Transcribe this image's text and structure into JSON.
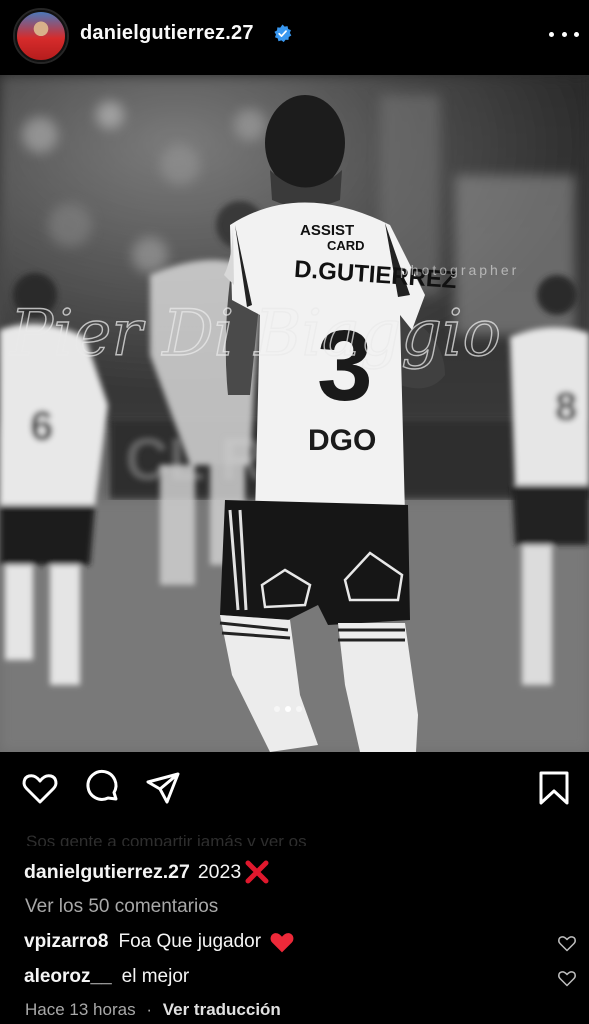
{
  "post": {
    "username": "danielgutierrez.27",
    "verified": true,
    "image_alt": "Black and white photo of a soccer player wearing number 3, D.GUTIERREZ, on the pitch",
    "jersey": {
      "sponsor_top": "ASSIST CARD",
      "name": "D.GUTIERREZ",
      "number": "3",
      "sponsor_bottom": "DGO"
    },
    "watermark": "Pier Di Biaggio",
    "watermark_sub": "photographer",
    "carousel": {
      "count": 3,
      "active_index": 1
    }
  },
  "caption": {
    "ghost_text": "Sos gente a compartir jamás y ver os",
    "username": "danielgutierrez.27",
    "text": "2023"
  },
  "view_comments": "Ver los 50 comentarios",
  "comments": [
    {
      "username": "vpizarro8",
      "text": "Foa Que jugador"
    },
    {
      "username": "aleoroz__",
      "text": "el mejor"
    }
  ],
  "meta": {
    "time": "Hace 13 horas",
    "separator": "·",
    "translate": "Ver traducción"
  },
  "colors": {
    "background": "#000000",
    "text": "#f5f5f5",
    "muted": "#a8a8a8",
    "verified": "#3897f0",
    "heart_red": "#ed4956"
  },
  "icons": [
    "more-icon",
    "heart-icon",
    "comment-icon",
    "share-icon",
    "bookmark-icon",
    "verified-icon"
  ]
}
